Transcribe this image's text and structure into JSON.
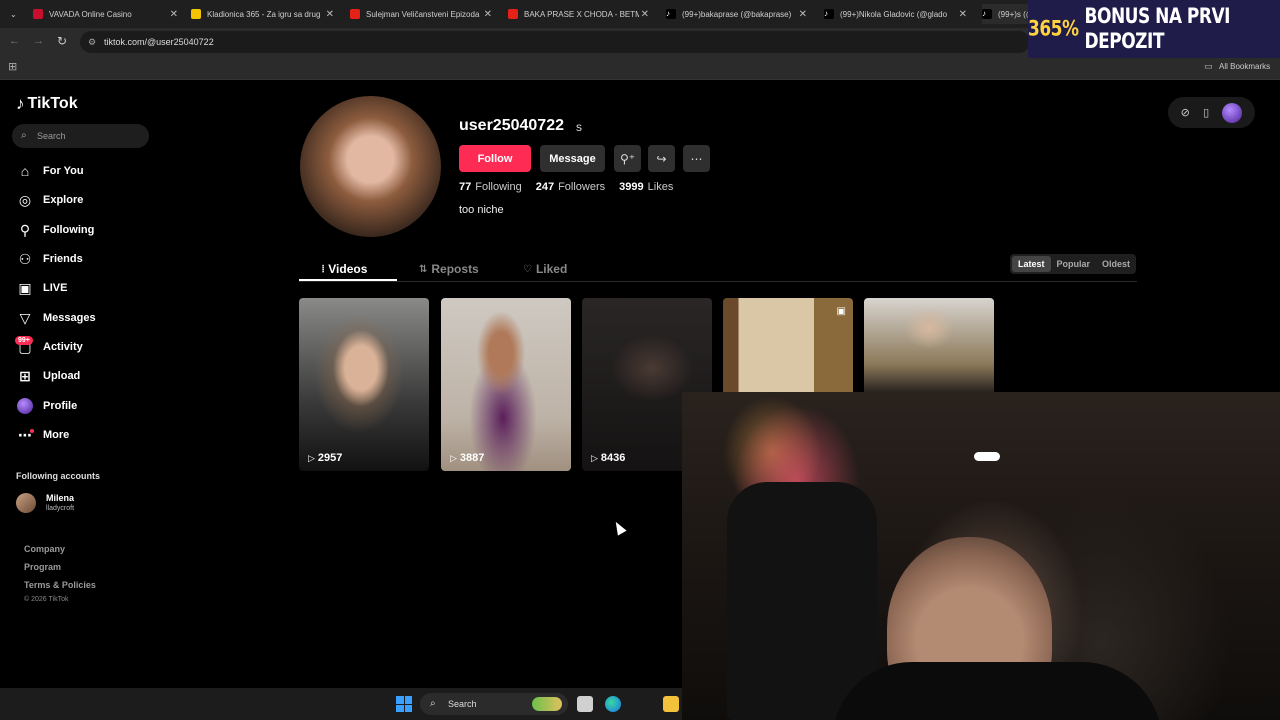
{
  "browser": {
    "tabs": [
      {
        "title": "VAVADA Online Casino",
        "favicon_color": "#c8102e"
      },
      {
        "title": "Kladionica 365 - Za igru sa drug",
        "favicon_color": "#f5c400"
      },
      {
        "title": "Sulejman Veličanstveni Epizoda",
        "favicon_color": "#e62117"
      },
      {
        "title": "BAKA PRASE X CHODA - BETMI",
        "favicon_color": "#e62117"
      },
      {
        "title": "(99+)bakaprase (@bakaprase)",
        "favicon_color": "#ffffff"
      },
      {
        "title": "(99+)Nikola Gladovic (@glado",
        "favicon_color": "#ffffff"
      },
      {
        "title": "(99+)s (@",
        "favicon_color": "#ffffff"
      }
    ],
    "url": "tiktok.com/@user25040722",
    "bookmarks_label": "All Bookmarks"
  },
  "promo": {
    "percent": "365%",
    "text": "BONUS NA PRVI DEPOZIT"
  },
  "sidebar": {
    "logo": "TikTok",
    "search_placeholder": "Search",
    "items": [
      {
        "label": "For You",
        "icon": "home-icon"
      },
      {
        "label": "Explore",
        "icon": "compass-icon"
      },
      {
        "label": "Following",
        "icon": "user-icon"
      },
      {
        "label": "Friends",
        "icon": "users-icon"
      },
      {
        "label": "LIVE",
        "icon": "live-icon"
      },
      {
        "label": "Messages",
        "icon": "send-icon"
      },
      {
        "label": "Activity",
        "icon": "inbox-icon"
      },
      {
        "label": "Upload",
        "icon": "plus-square-icon"
      },
      {
        "label": "Profile",
        "icon": "avatar-icon"
      },
      {
        "label": "More",
        "icon": "more-icon"
      }
    ],
    "activity_badge": "99+",
    "following_heading": "Following accounts",
    "following_accounts": [
      {
        "name": "Milena",
        "handle": "lladycroft"
      }
    ],
    "footer": [
      "Company",
      "Program",
      "Terms & Policies"
    ],
    "copyright": "© 2026 TikTok"
  },
  "profile": {
    "username": "user25040722",
    "nickname": "s",
    "follow_label": "Follow",
    "message_label": "Message",
    "stats": [
      {
        "value": "77",
        "label": "Following"
      },
      {
        "value": "247",
        "label": "Followers"
      },
      {
        "value": "3999",
        "label": "Likes"
      }
    ],
    "bio": "too niche"
  },
  "tabs": [
    {
      "label": "Videos",
      "icon": "grid-icon"
    },
    {
      "label": "Reposts",
      "icon": "repost-icon"
    },
    {
      "label": "Liked",
      "icon": "heart-icon"
    }
  ],
  "sort": {
    "options": [
      "Latest",
      "Popular",
      "Oldest"
    ],
    "selected": "Latest"
  },
  "videos": [
    {
      "views": "2957"
    },
    {
      "views": "3887"
    },
    {
      "views": "8436"
    },
    {
      "views": ""
    },
    {
      "views": ""
    }
  ],
  "taskbar": {
    "search_label": "Search"
  }
}
